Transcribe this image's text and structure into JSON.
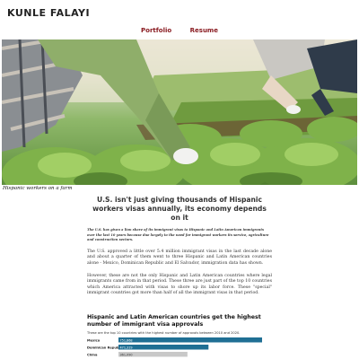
{
  "site": {
    "brand": "KUNLE FALAYI",
    "nav": [
      {
        "label": "Portfolio"
      },
      {
        "label": "Resume"
      }
    ]
  },
  "hero": {
    "caption": "Hispanic workers on a farm"
  },
  "article": {
    "title": "U.S. isn't just giving thousands of Hispanic workers visas annually, its economy depends on it",
    "lede": "The U.S. has given a lion share of its immigrant visas to Hispanic and Latin American immigrants over the last 10 years because due largely to the need for immigrant workers its service, agriculture and construction sectors.",
    "paragraphs": [
      "The U.S. approved a little over 5.4 million immigrant visas in the last decade alone and about a quarter of them went to three Hispanic and Latin American countries alone - Mexico, Dominican Republic and El Salvador, immigration data has shown.",
      "However, these are not the only Hispanic and Latin American countries where legal immigrants came from in that period. These three are just part of the top 10 countries which America attracted with visas to shore up its labor force. These \"special\" immigrant countries got more than half of all the immigrant visas in that period."
    ]
  },
  "chart_data": {
    "type": "bar",
    "title": "Hispanic and Latin American countries get the highest number of immigrant visa approvals",
    "subtitle": "These are the top 10 countries with the highest number of approvals between 2010 and 2020.",
    "categories": [
      "Mexico",
      "Dominican Republic",
      "China"
    ],
    "values": [
      751868,
      471319,
      361090
    ],
    "data_labels": [
      "751,868",
      "471,319",
      "361,090"
    ],
    "colors": [
      "#1f6f94",
      "#1f6f94",
      "#c8c8c8"
    ]
  }
}
